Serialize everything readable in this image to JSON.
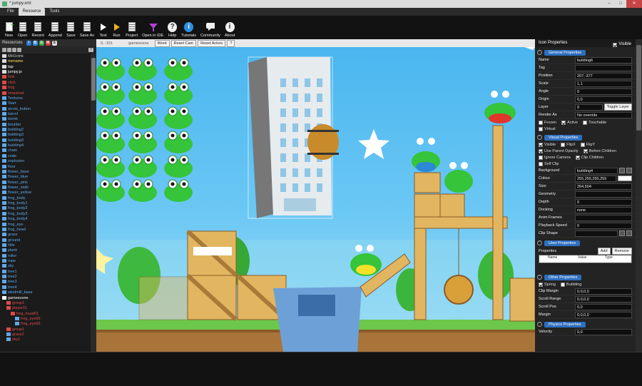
{
  "window": {
    "title": "* jumpy.xml"
  },
  "menu": [
    "File",
    "Resource",
    "Tools"
  ],
  "toolbar": [
    {
      "label": "New",
      "icon": "new-document-icon"
    },
    {
      "label": "Open",
      "icon": "open-document-icon"
    },
    {
      "label": "Recent",
      "icon": "recent-document-icon"
    },
    {
      "label": "Append",
      "icon": "append-document-icon"
    },
    {
      "label": "Save",
      "icon": "save-icon"
    },
    {
      "label": "Save As",
      "icon": "save-as-icon"
    },
    {
      "label": "Test",
      "icon": "test-play-icon"
    },
    {
      "label": "Run",
      "icon": "run-play-icon"
    },
    {
      "label": "Project",
      "icon": "project-icon"
    },
    {
      "label": "Open in IDE",
      "icon": "ide-funnel-icon"
    },
    {
      "label": "Help",
      "icon": "help-icon"
    },
    {
      "label": "Tutorials",
      "icon": "tutorials-info-icon"
    },
    {
      "label": "Community",
      "icon": "community-chat-icon"
    },
    {
      "label": "About",
      "icon": "about-info-icon"
    }
  ],
  "resources": {
    "title": "Resources",
    "chips": [
      {
        "t": "I",
        "c": "#2e77c8"
      },
      {
        "t": "B",
        "c": "#3b8be0"
      },
      {
        "t": "G",
        "c": "#3aa745"
      },
      {
        "t": "M",
        "c": "#d23b3b"
      },
      {
        "t": "S",
        "c": "#dddddd"
      }
    ],
    "items": [
      {
        "label": "MH1ctrls",
        "color": "#cfcfcf",
        "indent": 0,
        "icon": "file-icon"
      },
      {
        "label": "mename",
        "color": "#ffe15a",
        "indent": 0,
        "icon": "file-icon"
      },
      {
        "label": "tap",
        "color": "#ffffff",
        "indent": 0,
        "icon": "file-icon"
      },
      {
        "label": "jumpy.js",
        "color": "#ffffff",
        "indent": 0,
        "icon": "file-icon"
      },
      {
        "label": "font",
        "color": "#e04a4a",
        "indent": 0,
        "icon": "font-icon"
      },
      {
        "label": "click",
        "color": "#e04a4a",
        "indent": 0,
        "icon": "sound-icon"
      },
      {
        "label": "frog",
        "color": "#e04a4a",
        "indent": 0,
        "icon": "sound-icon"
      },
      {
        "label": "smashed",
        "color": "#e04a4a",
        "indent": 0,
        "icon": "sound-icon"
      },
      {
        "label": "Textures",
        "color": "#5fa8e8",
        "indent": 0,
        "icon": "image-icon"
      },
      {
        "label": "Start",
        "color": "#5fa8e8",
        "indent": 0,
        "icon": "image-icon"
      },
      {
        "label": "arrow_button",
        "color": "#5fa8e8",
        "indent": 0,
        "icon": "image-icon"
      },
      {
        "label": "barrel",
        "color": "#5fa8e8",
        "indent": 0,
        "icon": "image-icon"
      },
      {
        "label": "bomb",
        "color": "#5fa8e8",
        "indent": 0,
        "icon": "image-icon"
      },
      {
        "label": "boulder",
        "color": "#5fa8e8",
        "indent": 0,
        "icon": "image-icon"
      },
      {
        "label": "building2",
        "color": "#5fa8e8",
        "indent": 0,
        "icon": "image-icon"
      },
      {
        "label": "building3",
        "color": "#5fa8e8",
        "indent": 0,
        "icon": "image-icon"
      },
      {
        "label": "building3",
        "color": "#5fa8e8",
        "indent": 0,
        "icon": "image-icon"
      },
      {
        "label": "building4",
        "color": "#5fa8e8",
        "indent": 0,
        "icon": "image-icon"
      },
      {
        "label": "chain",
        "color": "#5fa8e8",
        "indent": 0,
        "icon": "image-icon"
      },
      {
        "label": "crate",
        "color": "#5fa8e8",
        "indent": 0,
        "icon": "image-icon"
      },
      {
        "label": "explosion",
        "color": "#5fa8e8",
        "indent": 0,
        "icon": "image-icon"
      },
      {
        "label": "floor",
        "color": "#5fa8e8",
        "indent": 0,
        "icon": "image-icon"
      },
      {
        "label": "flower_base",
        "color": "#5fa8e8",
        "indent": 0,
        "icon": "image-icon"
      },
      {
        "label": "flower_blue",
        "color": "#5fa8e8",
        "indent": 0,
        "icon": "image-icon"
      },
      {
        "label": "flower_pink",
        "color": "#5fa8e8",
        "indent": 0,
        "icon": "image-icon"
      },
      {
        "label": "flower_stalk",
        "color": "#5fa8e8",
        "indent": 0,
        "icon": "image-icon"
      },
      {
        "label": "flower_yellow",
        "color": "#5fa8e8",
        "indent": 0,
        "icon": "image-icon"
      },
      {
        "label": "frog_body",
        "color": "#5fa8e8",
        "indent": 0,
        "icon": "image-icon"
      },
      {
        "label": "frog_body1",
        "color": "#5fa8e8",
        "indent": 0,
        "icon": "image-icon"
      },
      {
        "label": "frog_body2",
        "color": "#5fa8e8",
        "indent": 0,
        "icon": "image-icon"
      },
      {
        "label": "frog_body3",
        "color": "#5fa8e8",
        "indent": 0,
        "icon": "image-icon"
      },
      {
        "label": "frog_body4",
        "color": "#5fa8e8",
        "indent": 0,
        "icon": "image-icon"
      },
      {
        "label": "frog_eye",
        "color": "#5fa8e8",
        "indent": 0,
        "icon": "image-icon"
      },
      {
        "label": "frog_head",
        "color": "#5fa8e8",
        "indent": 0,
        "icon": "image-icon"
      },
      {
        "label": "grass",
        "color": "#5fa8e8",
        "indent": 0,
        "icon": "image-icon"
      },
      {
        "label": "ground",
        "color": "#5fa8e8",
        "indent": 0,
        "icon": "image-icon"
      },
      {
        "label": "hills",
        "color": "#5fa8e8",
        "indent": 0,
        "icon": "image-icon"
      },
      {
        "label": "plank",
        "color": "#5fa8e8",
        "indent": 0,
        "icon": "image-icon"
      },
      {
        "label": "roller",
        "color": "#5fa8e8",
        "indent": 0,
        "icon": "image-icon"
      },
      {
        "label": "rope",
        "color": "#5fa8e8",
        "indent": 0,
        "icon": "image-icon"
      },
      {
        "label": "sky",
        "color": "#5fa8e8",
        "indent": 0,
        "icon": "image-icon"
      },
      {
        "label": "tree1",
        "color": "#5fa8e8",
        "indent": 0,
        "icon": "image-icon"
      },
      {
        "label": "tree2",
        "color": "#5fa8e8",
        "indent": 0,
        "icon": "image-icon"
      },
      {
        "label": "tree3",
        "color": "#5fa8e8",
        "indent": 0,
        "icon": "image-icon"
      },
      {
        "label": "tree4",
        "color": "#5fa8e8",
        "indent": 0,
        "icon": "image-icon"
      },
      {
        "label": "windmill_base",
        "color": "#5fa8e8",
        "indent": 0,
        "icon": "image-icon"
      },
      {
        "label": "gamescene",
        "color": "#ffffff",
        "indent": 0,
        "icon": "scene-icon"
      },
      {
        "label": "group1",
        "color": "#e04a4a",
        "indent": 1,
        "icon": "group-icon"
      },
      {
        "label": "player01",
        "color": "#e04a4a",
        "indent": 1,
        "icon": "group-icon"
      },
      {
        "label": "frog_head01",
        "color": "#e04a4a",
        "indent": 2,
        "icon": "group-icon"
      },
      {
        "label": "frog_eye96",
        "color": "#e04a4a",
        "indent": 3,
        "icon": "image-icon"
      },
      {
        "label": "frog_eye96",
        "color": "#e04a4a",
        "indent": 3,
        "icon": "image-icon"
      },
      {
        "label": "group1",
        "color": "#e04a4a",
        "indent": 1,
        "icon": "group-icon"
      },
      {
        "label": "grass2",
        "color": "#e04a4a",
        "indent": 1,
        "icon": "image-icon"
      },
      {
        "label": "sky1",
        "color": "#e04a4a",
        "indent": 1,
        "icon": "image-icon"
      }
    ]
  },
  "scenebar": {
    "coords": "0, -151",
    "scene": "gamescene",
    "buttons": [
      "Word",
      "Reset Cam",
      "Reset Actors"
    ],
    "help": "?"
  },
  "props": {
    "title": "Icon Properties",
    "visible_label": "Visible",
    "general": {
      "title": "General Properties",
      "rows": [
        {
          "k": "Name",
          "v": "building6"
        },
        {
          "k": "Tag",
          "v": ""
        },
        {
          "k": "Position",
          "v": "207,-377"
        },
        {
          "k": "Scale",
          "v": "1,1"
        },
        {
          "k": "Angle",
          "v": "0"
        },
        {
          "k": "Origin",
          "v": "0,0"
        },
        {
          "k": "Layer",
          "v": "0"
        }
      ],
      "layer_button": "Toggle Layer",
      "render_as": {
        "k": "Render As",
        "v": "No override"
      },
      "checks": [
        [
          {
            "l": "Frozen",
            "on": false
          },
          {
            "l": "Active",
            "on": true
          },
          {
            "l": "Touchable",
            "on": false
          }
        ],
        [
          {
            "l": "Virtual",
            "on": false
          }
        ]
      ]
    },
    "visual": {
      "title": "Visual Properties",
      "checks": [
        [
          {
            "l": "Visible",
            "on": true
          },
          {
            "l": "FlipX",
            "on": false
          },
          {
            "l": "FlipY",
            "on": false
          }
        ],
        [
          {
            "l": "Use Parent Opacity",
            "on": true
          },
          {
            "l": "Before Children",
            "on": true
          }
        ],
        [
          {
            "l": "Ignore Camera",
            "on": false
          },
          {
            "l": "Clip Children",
            "on": true
          }
        ],
        [
          {
            "l": "Self Clip",
            "on": false
          }
        ]
      ],
      "rows": [
        {
          "k": "Background",
          "v": "building4"
        },
        {
          "k": "Colour",
          "v": "255,255,255,255"
        },
        {
          "k": "Size",
          "v": "264,504"
        },
        {
          "k": "Geometry",
          "v": ""
        },
        {
          "k": "Depth",
          "v": "0"
        },
        {
          "k": "Docking",
          "v": "none"
        },
        {
          "k": "Anim Frames",
          "v": ""
        },
        {
          "k": "Playback Speed",
          "v": "0"
        },
        {
          "k": "Clip Shape",
          "v": ""
        }
      ]
    },
    "user": {
      "title": "User Properties",
      "label": "Properties",
      "add": "Add",
      "remove": "Remove",
      "cols": [
        "Name",
        "Value",
        "Type"
      ]
    },
    "other": {
      "title": "Other Properties",
      "checks": [
        {
          "l": "Spring",
          "on": true
        },
        {
          "l": "Bubbling",
          "on": false
        }
      ],
      "rows": [
        {
          "k": "Clip Margin",
          "v": "0,0,0,0"
        },
        {
          "k": "Scroll Range",
          "v": "0,0,0,0"
        },
        {
          "k": "Scroll Pos",
          "v": "0,0"
        },
        {
          "k": "Margin",
          "v": "0,0,0,0"
        }
      ]
    },
    "physics": {
      "title": "Physics Properties",
      "rows": [
        {
          "k": "Velocity",
          "v": "0,0"
        }
      ]
    }
  },
  "colors": {
    "accent": "#2e6fbf",
    "frog": "#35c43a",
    "sky": "#4ab6ef",
    "crate": "#e0b45a"
  }
}
